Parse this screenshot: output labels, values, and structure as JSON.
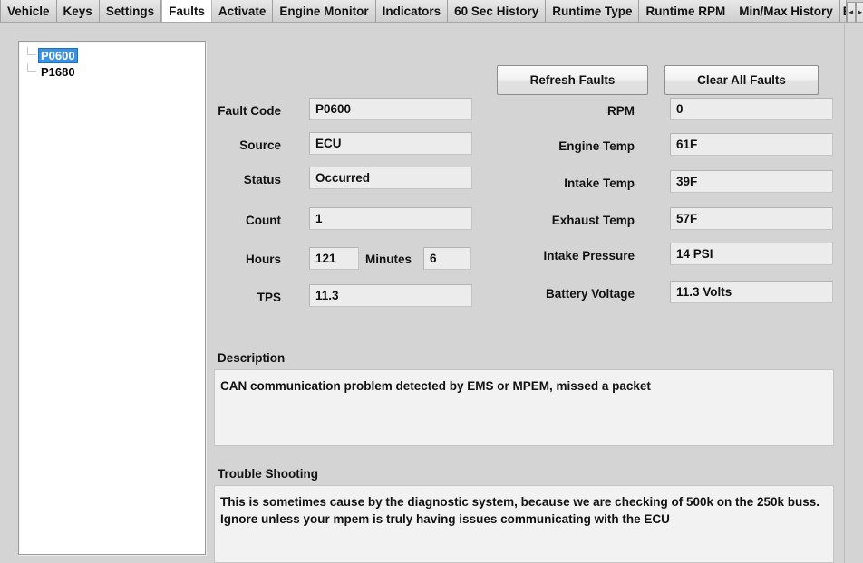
{
  "tabs": [
    {
      "label": "Vehicle",
      "active": false
    },
    {
      "label": "Keys",
      "active": false
    },
    {
      "label": "Settings",
      "active": false
    },
    {
      "label": "Faults",
      "active": true
    },
    {
      "label": "Activate",
      "active": false
    },
    {
      "label": "Engine Monitor",
      "active": false
    },
    {
      "label": "Indicators",
      "active": false
    },
    {
      "label": "60 Sec History",
      "active": false
    },
    {
      "label": "Runtime Type",
      "active": false
    },
    {
      "label": "Runtime RPM",
      "active": false
    },
    {
      "label": "Min/Max History",
      "active": false
    },
    {
      "label": "E",
      "active": false
    }
  ],
  "tab_scroll": {
    "left_arrow": "◄",
    "right_arrow": "►"
  },
  "fault_list": {
    "items": [
      {
        "code": "P0600",
        "selected": true
      },
      {
        "code": "P1680",
        "selected": false
      }
    ]
  },
  "toolbar": {
    "refresh_label": "Refresh Faults",
    "clear_label": "Clear All Faults"
  },
  "left_fields": [
    {
      "label": "Fault Code",
      "value": "P0600"
    },
    {
      "label": "Source",
      "value": "ECU"
    },
    {
      "label": "Status",
      "value": "Occurred"
    },
    {
      "label": "Count",
      "value": "1"
    },
    {
      "label": "TPS",
      "value": "11.3"
    }
  ],
  "hours_row": {
    "hours_label": "Hours",
    "hours_value": "121",
    "minutes_label": "Minutes",
    "minutes_value": "6"
  },
  "right_fields": [
    {
      "label": "RPM",
      "value": "0"
    },
    {
      "label": "Engine Temp",
      "value": "61F"
    },
    {
      "label": "Intake Temp",
      "value": "39F"
    },
    {
      "label": "Exhaust Temp",
      "value": "57F"
    },
    {
      "label": "Intake Pressure",
      "value": "14 PSI"
    },
    {
      "label": "Battery Voltage",
      "value": "11.3  Volts"
    }
  ],
  "description": {
    "title": "Description",
    "text": "CAN communication problem detected by EMS or MPEM, missed a packet"
  },
  "trouble_shooting": {
    "title": "Trouble Shooting",
    "text": "This is sometimes cause by the diagnostic system, because we are checking of 500k on the 250k buss. Ignore unless your mpem is truly having issues communicating with the ECU"
  },
  "colors": {
    "window_background": "#d4d4d4",
    "field_background": "#ececec",
    "selection_blue": "#3a93e0",
    "panel_white": "#ffffff"
  }
}
